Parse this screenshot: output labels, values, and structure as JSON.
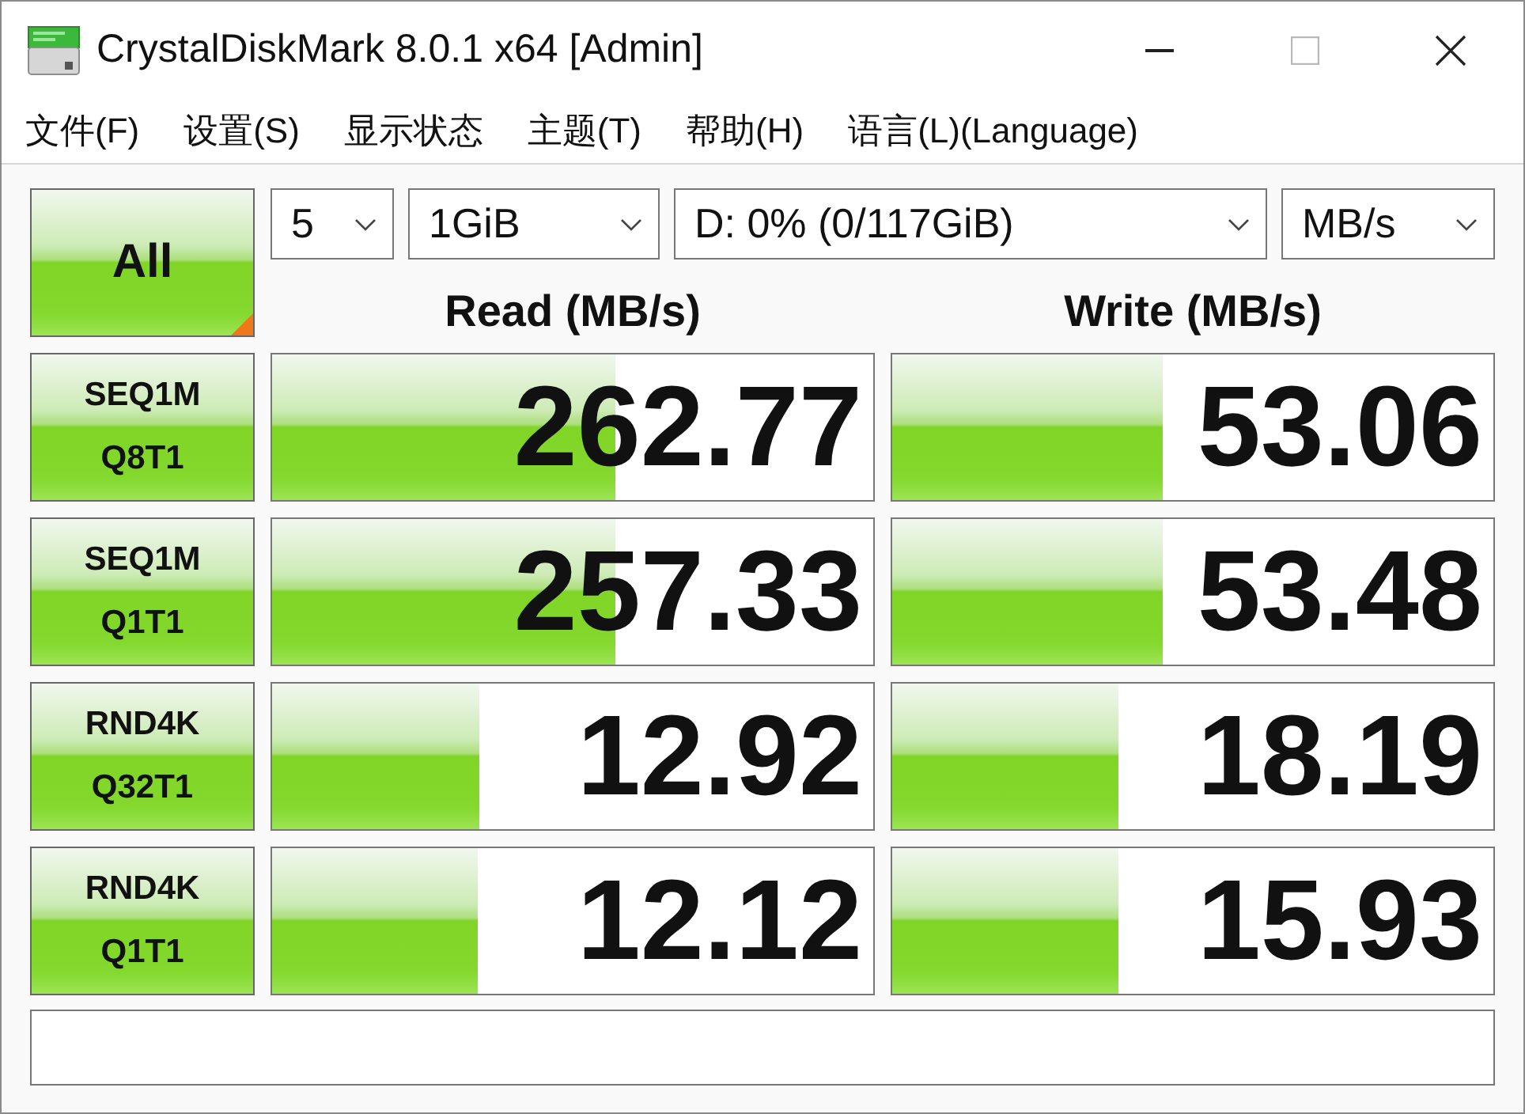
{
  "window": {
    "title": "CrystalDiskMark 8.0.1 x64 [Admin]",
    "maximize_disabled": true
  },
  "menu": [
    "文件(F)",
    "设置(S)",
    "显示状态",
    "主题(T)",
    "帮助(H)",
    "语言(L)(Language)"
  ],
  "controls": {
    "start_all": "All",
    "selectors": [
      {
        "value": "5"
      },
      {
        "value": "1GiB"
      },
      {
        "value": "D: 0% (0/117GiB)"
      },
      {
        "value": "MB/s"
      }
    ]
  },
  "columns": [
    "Read (MB/s)",
    "Write (MB/s)"
  ],
  "tests": [
    {
      "label": [
        "SEQ1M",
        "Q8T1"
      ],
      "read": {
        "value": "262.77",
        "level": 0.57
      },
      "write": {
        "value": "53.06",
        "level": 0.45
      }
    },
    {
      "label": [
        "SEQ1M",
        "Q1T1"
      ],
      "read": {
        "value": "257.33",
        "level": 0.57
      },
      "write": {
        "value": "53.48",
        "level": 0.45
      }
    },
    {
      "label": [
        "RND4K",
        "Q32T1"
      ],
      "read": {
        "value": "12.92",
        "level": 0.345
      },
      "write": {
        "value": "18.19",
        "level": 0.375
      }
    },
    {
      "label": [
        "RND4K",
        "Q1T1"
      ],
      "read": {
        "value": "12.12",
        "level": 0.343
      },
      "write": {
        "value": "15.93",
        "level": 0.375
      }
    }
  ]
}
